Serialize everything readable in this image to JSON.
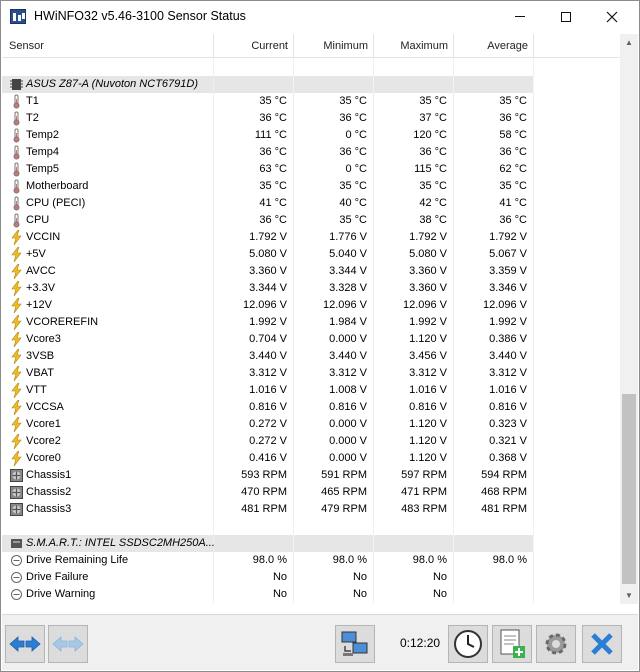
{
  "window": {
    "title": "HWiNFO32 v5.46-3100 Sensor Status"
  },
  "columns": {
    "sensor": "Sensor",
    "current": "Current",
    "minimum": "Minimum",
    "maximum": "Maximum",
    "average": "Average"
  },
  "rows": [
    {
      "type": "blank"
    },
    {
      "type": "group",
      "icon": "chip-icon",
      "name": "ASUS Z87-A (Nuvoton NCT6791D)"
    },
    {
      "type": "temp",
      "icon": "thermometer-icon",
      "name": "T1",
      "cur": "35 °C",
      "min": "35 °C",
      "max": "35 °C",
      "avg": "35 °C"
    },
    {
      "type": "temp",
      "icon": "thermometer-icon",
      "name": "T2",
      "cur": "36 °C",
      "min": "36 °C",
      "max": "37 °C",
      "avg": "36 °C"
    },
    {
      "type": "temp",
      "icon": "thermometer-icon",
      "name": "Temp2",
      "cur": "111 °C",
      "min": "0 °C",
      "max": "120 °C",
      "avg": "58 °C"
    },
    {
      "type": "temp",
      "icon": "thermometer-icon",
      "name": "Temp4",
      "cur": "36 °C",
      "min": "36 °C",
      "max": "36 °C",
      "avg": "36 °C"
    },
    {
      "type": "temp",
      "icon": "thermometer-icon",
      "name": "Temp5",
      "cur": "63 °C",
      "min": "0 °C",
      "max": "115 °C",
      "avg": "62 °C"
    },
    {
      "type": "temp",
      "icon": "thermometer-icon",
      "name": "Motherboard",
      "cur": "35 °C",
      "min": "35 °C",
      "max": "35 °C",
      "avg": "35 °C"
    },
    {
      "type": "temp",
      "icon": "thermometer-icon",
      "name": "CPU (PECI)",
      "cur": "41 °C",
      "min": "40 °C",
      "max": "42 °C",
      "avg": "41 °C"
    },
    {
      "type": "temp",
      "icon": "thermometer-icon",
      "name": "CPU",
      "cur": "36 °C",
      "min": "35 °C",
      "max": "38 °C",
      "avg": "36 °C"
    },
    {
      "type": "volt",
      "icon": "lightning-icon",
      "name": "VCCIN",
      "cur": "1.792 V",
      "min": "1.776 V",
      "max": "1.792 V",
      "avg": "1.792 V"
    },
    {
      "type": "volt",
      "icon": "lightning-icon",
      "name": "+5V",
      "cur": "5.080 V",
      "min": "5.040 V",
      "max": "5.080 V",
      "avg": "5.067 V"
    },
    {
      "type": "volt",
      "icon": "lightning-icon",
      "name": "AVCC",
      "cur": "3.360 V",
      "min": "3.344 V",
      "max": "3.360 V",
      "avg": "3.359 V"
    },
    {
      "type": "volt",
      "icon": "lightning-icon",
      "name": "+3.3V",
      "cur": "3.344 V",
      "min": "3.328 V",
      "max": "3.360 V",
      "avg": "3.346 V"
    },
    {
      "type": "volt",
      "icon": "lightning-icon",
      "name": "+12V",
      "cur": "12.096 V",
      "min": "12.096 V",
      "max": "12.096 V",
      "avg": "12.096 V"
    },
    {
      "type": "volt",
      "icon": "lightning-icon",
      "name": "VCOREREFIN",
      "cur": "1.992 V",
      "min": "1.984 V",
      "max": "1.992 V",
      "avg": "1.992 V"
    },
    {
      "type": "volt",
      "icon": "lightning-icon",
      "name": "Vcore3",
      "cur": "0.704 V",
      "min": "0.000 V",
      "max": "1.120 V",
      "avg": "0.386 V"
    },
    {
      "type": "volt",
      "icon": "lightning-icon",
      "name": "3VSB",
      "cur": "3.440 V",
      "min": "3.440 V",
      "max": "3.456 V",
      "avg": "3.440 V"
    },
    {
      "type": "volt",
      "icon": "lightning-icon",
      "name": "VBAT",
      "cur": "3.312 V",
      "min": "3.312 V",
      "max": "3.312 V",
      "avg": "3.312 V"
    },
    {
      "type": "volt",
      "icon": "lightning-icon",
      "name": "VTT",
      "cur": "1.016 V",
      "min": "1.008 V",
      "max": "1.016 V",
      "avg": "1.016 V"
    },
    {
      "type": "volt",
      "icon": "lightning-icon",
      "name": "VCCSA",
      "cur": "0.816 V",
      "min": "0.816 V",
      "max": "0.816 V",
      "avg": "0.816 V"
    },
    {
      "type": "volt",
      "icon": "lightning-icon",
      "name": "Vcore1",
      "cur": "0.272 V",
      "min": "0.000 V",
      "max": "1.120 V",
      "avg": "0.323 V"
    },
    {
      "type": "volt",
      "icon": "lightning-icon",
      "name": "Vcore2",
      "cur": "0.272 V",
      "min": "0.000 V",
      "max": "1.120 V",
      "avg": "0.321 V"
    },
    {
      "type": "volt",
      "icon": "lightning-icon",
      "name": "Vcore0",
      "cur": "0.416 V",
      "min": "0.000 V",
      "max": "1.120 V",
      "avg": "0.368 V"
    },
    {
      "type": "fan",
      "icon": "fan-icon",
      "name": "Chassis1",
      "cur": "593 RPM",
      "min": "591 RPM",
      "max": "597 RPM",
      "avg": "594 RPM"
    },
    {
      "type": "fan",
      "icon": "fan-icon",
      "name": "Chassis2",
      "cur": "470 RPM",
      "min": "465 RPM",
      "max": "471 RPM",
      "avg": "468 RPM"
    },
    {
      "type": "fan",
      "icon": "fan-icon",
      "name": "Chassis3",
      "cur": "481 RPM",
      "min": "479 RPM",
      "max": "483 RPM",
      "avg": "481 RPM"
    },
    {
      "type": "blank"
    },
    {
      "type": "group",
      "icon": "drive-icon",
      "name": "S.M.A.R.T.: INTEL SSDSC2MH250A..."
    },
    {
      "type": "status",
      "icon": "status-circle-icon",
      "name": "Drive Remaining Life",
      "cur": "98.0 %",
      "min": "98.0 %",
      "max": "98.0 %",
      "avg": "98.0 %"
    },
    {
      "type": "status",
      "icon": "status-circle-icon",
      "name": "Drive Failure",
      "cur": "No",
      "min": "No",
      "max": "No",
      "avg": ""
    },
    {
      "type": "status",
      "icon": "status-circle-icon",
      "name": "Drive Warning",
      "cur": "No",
      "min": "No",
      "max": "No",
      "avg": ""
    }
  ],
  "toolbar": {
    "elapsed": "0:12:20",
    "buttons": [
      "navigate-arrows-icon",
      "navigate-arrows-disabled-icon",
      "network-computers-icon",
      "clock-icon",
      "add-report-icon",
      "settings-gear-icon",
      "close-x-icon"
    ]
  },
  "colors": {
    "group_bg": "#e6e6e6",
    "volt_icon": "#f0c020",
    "toolbar_bg": "#f0f0f0",
    "accent_blue": "#2a7fd4"
  }
}
